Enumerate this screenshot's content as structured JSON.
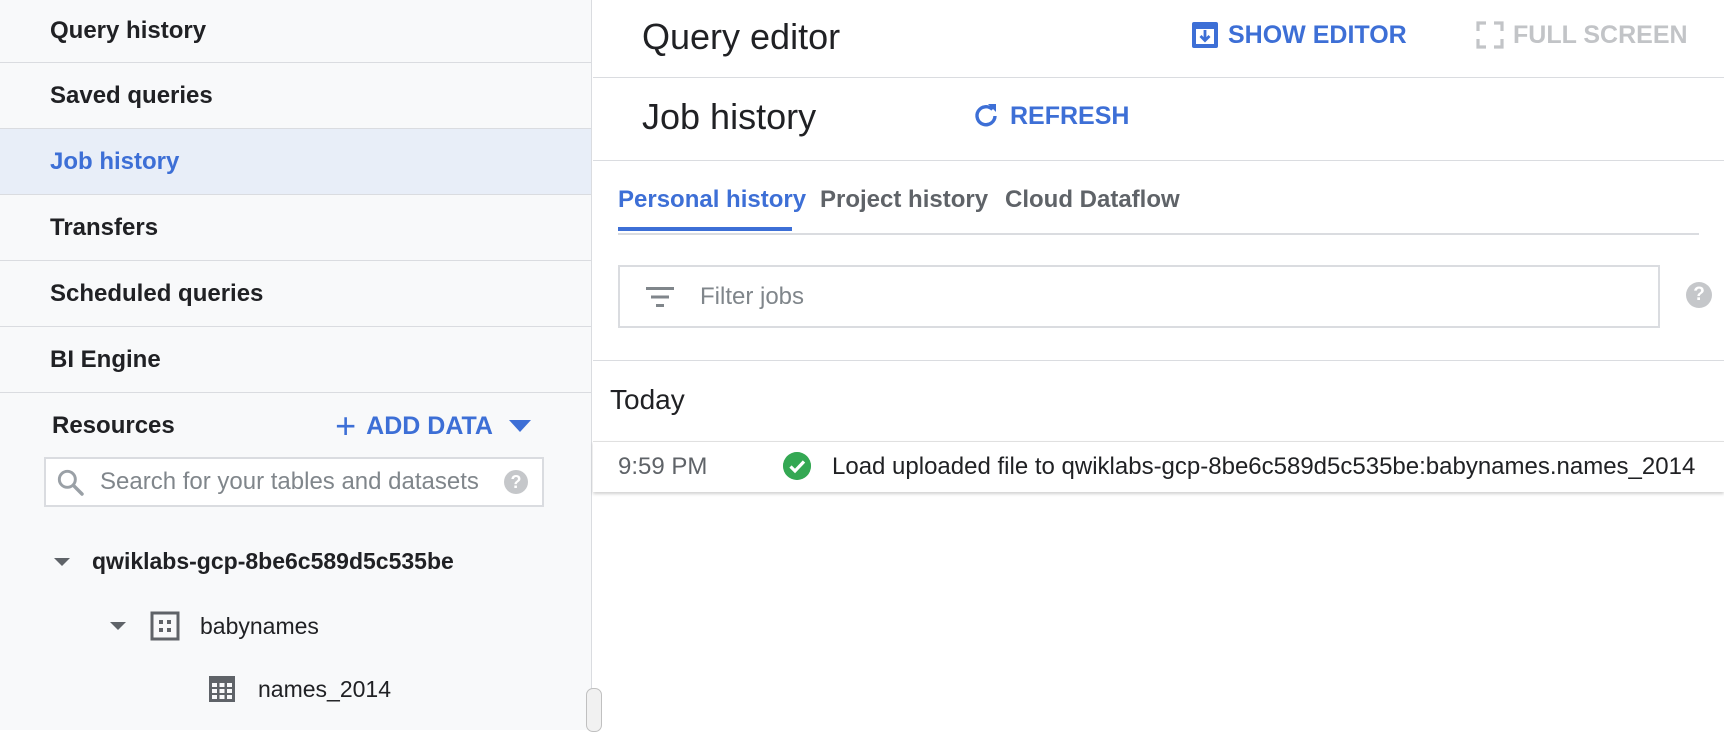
{
  "sidebar": {
    "items": [
      {
        "label": "Query history"
      },
      {
        "label": "Saved queries"
      },
      {
        "label": "Job history"
      },
      {
        "label": "Transfers"
      },
      {
        "label": "Scheduled queries"
      },
      {
        "label": "BI Engine"
      }
    ],
    "active_index": 2,
    "resources_title": "Resources",
    "add_data_label": "ADD DATA",
    "search_placeholder": "Search for your tables and datasets",
    "search_help": "?",
    "tree": {
      "project": "qwiklabs-gcp-8be6c589d5c535be",
      "dataset": "babynames",
      "table": "names_2014"
    }
  },
  "header": {
    "title": "Query editor",
    "show_editor_label": "SHOW EDITOR",
    "full_screen_label": "FULL SCREEN"
  },
  "job_history": {
    "title": "Job history",
    "refresh_label": "REFRESH",
    "tabs": [
      {
        "label": "Personal history"
      },
      {
        "label": "Project history"
      },
      {
        "label": "Cloud Dataflow"
      }
    ],
    "active_tab": 0,
    "filter_placeholder": "Filter jobs",
    "filter_help": "?",
    "group_label": "Today",
    "jobs": [
      {
        "time": "9:59 PM",
        "status": "success",
        "description": "Load uploaded file to qwiklabs-gcp-8be6c589d5c535be:babynames.names_2014"
      }
    ]
  },
  "colors": {
    "accent": "#3d6fd6",
    "active_bg": "#e8eef8",
    "success": "#34a853",
    "disabled": "#c2c4c7"
  }
}
